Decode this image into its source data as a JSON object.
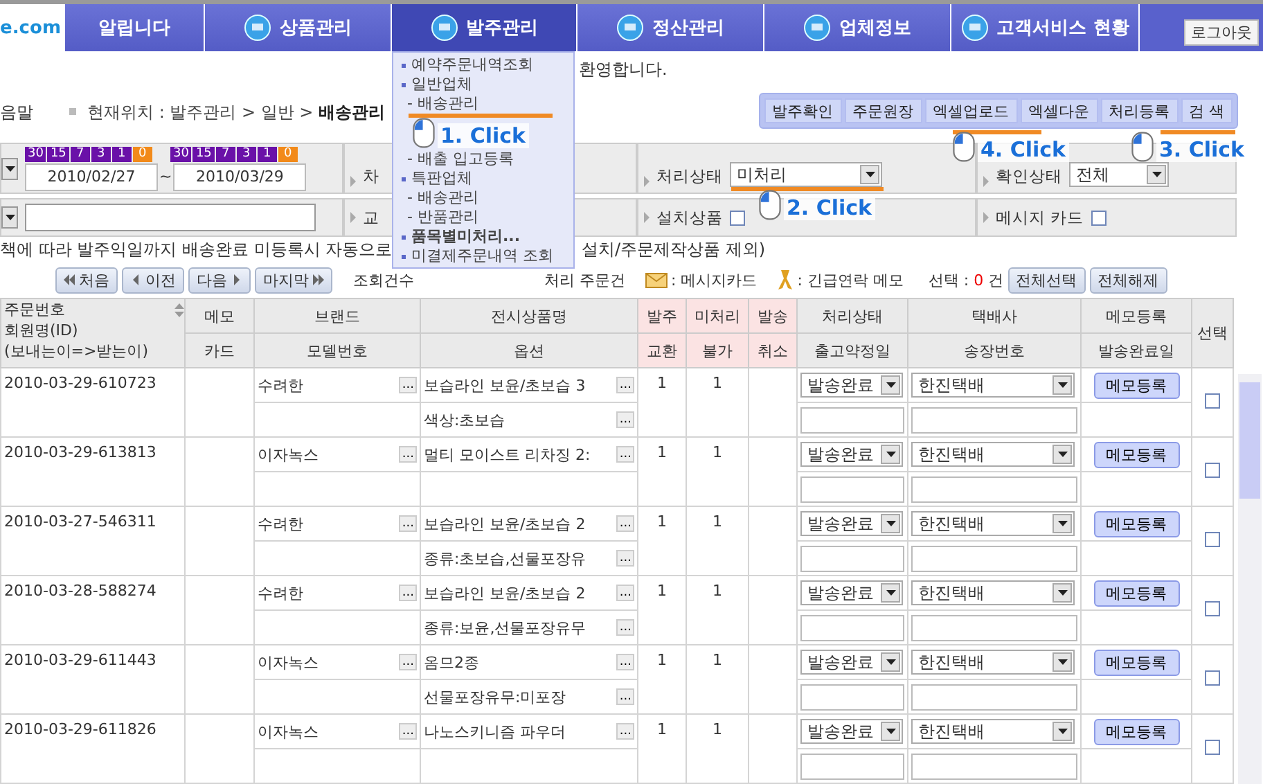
{
  "logo": "e.com",
  "nav": {
    "tabs": [
      {
        "label": "알립니다",
        "selected": false,
        "kind": "plain"
      },
      {
        "label": "상품관리",
        "selected": false,
        "kind": "icon"
      },
      {
        "label": "발주관리",
        "selected": true,
        "kind": "icon"
      },
      {
        "label": "정산관리",
        "selected": false,
        "kind": "icon"
      },
      {
        "label": "업체정보",
        "selected": false,
        "kind": "icon"
      },
      {
        "label": "고객서비스 현황",
        "selected": false,
        "kind": "icon"
      }
    ],
    "logout": "로그아웃"
  },
  "welcome": "환영합니다.",
  "side_label": "음말",
  "breadcrumb": "현재위치 : 발주관리 > 일반 > **배송관리**",
  "actions": [
    "발주확인",
    "주문원장",
    "엑셀업로드",
    "엑셀다운",
    "처리등록",
    "검 색"
  ],
  "filters": {
    "quick_ranges": [
      [
        {
          "label": "30",
          "color": "#6a11a8"
        },
        {
          "label": "15",
          "color": "#6a11a8"
        },
        {
          "label": "7",
          "color": "#6a11a8"
        },
        {
          "label": "3",
          "color": "#6a11a8"
        },
        {
          "label": "1",
          "color": "#6a11a8"
        },
        {
          "label": "0",
          "color": "#f28a1a"
        }
      ],
      [
        {
          "label": "30",
          "color": "#6a11a8"
        },
        {
          "label": "15",
          "color": "#6a11a8"
        },
        {
          "label": "7",
          "color": "#6a11a8"
        },
        {
          "label": "3",
          "color": "#6a11a8"
        },
        {
          "label": "1",
          "color": "#6a11a8"
        },
        {
          "label": "0",
          "color": "#f28a1a"
        }
      ]
    ],
    "date_from": "2010/02/27",
    "date_sep": "~",
    "date_to": "2010/03/29",
    "round_label": "차",
    "exchange_label": "교",
    "status": {
      "label": "처리상태",
      "value": "미처리"
    },
    "confirm": {
      "label": "확인상태",
      "value": "전체"
    },
    "install": {
      "label": "설치상품",
      "checked": false
    },
    "card": {
      "label": "메시지 카드",
      "checked": false
    }
  },
  "notice_left": "책에 따라 발주익일까지 배송완료 미등록시 자동으로",
  "notice_right": "설치/주문제작상품 제외)",
  "pager": [
    "처음",
    "이전",
    "다음",
    "마지막"
  ],
  "count_label": "조회건수",
  "pending_label": "처리 주문건",
  "legend": [
    {
      "kind": "envelope",
      "text": ": 메시지카드"
    },
    {
      "kind": "ribbon",
      "text": ": 긴급연락 메모"
    }
  ],
  "selection": {
    "label": "선택 :",
    "count": "0",
    "unit": "건"
  },
  "select_all": "전체선택",
  "clear_all": "전체해제",
  "table": {
    "columns": [
      {
        "kind": "stacked",
        "lines": [
          "주문번호",
          "회원명(ID)",
          "(보내는이=>받는이)"
        ],
        "highlight": false
      },
      {
        "kind": "split",
        "top": "메모",
        "bottom": "카드",
        "highlight": false
      },
      {
        "kind": "split",
        "top": "브랜드",
        "bottom": "모델번호",
        "highlight": false
      },
      {
        "kind": "split",
        "top": "전시상품명",
        "bottom": "옵션",
        "highlight": false
      },
      {
        "kind": "split",
        "top": "발주",
        "bottom": "교환",
        "highlight": true
      },
      {
        "kind": "split",
        "top": "미처리",
        "bottom": "불가",
        "highlight": true
      },
      {
        "kind": "split",
        "top": "발송",
        "bottom": "취소",
        "highlight": true
      },
      {
        "kind": "split",
        "top": "처리상태",
        "bottom": "출고약정일",
        "highlight": false
      },
      {
        "kind": "split",
        "top": "택배사",
        "bottom": "송장번호",
        "highlight": false
      },
      {
        "kind": "split",
        "top": "메모등록",
        "bottom": "발송완료일",
        "highlight": false
      },
      {
        "kind": "single",
        "top": "선택",
        "highlight": false
      }
    ],
    "rows": [
      {
        "order_no": "2010-03-29-610723",
        "brand": "수려한",
        "brand_more": "...",
        "product": "보습라인 보윤/초보습 3",
        "product_more": "...",
        "option": "색상:초보습",
        "option_more": "...",
        "ordered": "1",
        "pending": "1",
        "status": "발송완료",
        "courier": "한진택배",
        "memo_button": "메모등록",
        "checked": false
      },
      {
        "order_no": "2010-03-29-613813",
        "brand": "이자녹스",
        "brand_more": "...",
        "product": "멀티 모이스트 리차징 2:",
        "product_more": "...",
        "ordered": "1",
        "pending": "1",
        "status": "발송완료",
        "courier": "한진택배",
        "memo_button": "메모등록",
        "checked": false
      },
      {
        "order_no": "2010-03-27-546311",
        "brand": "수려한",
        "brand_more": "...",
        "product": "보습라인 보윤/초보습 2",
        "product_more": "...",
        "option": "종류:초보습,선물포장유",
        "option_more": "...",
        "ordered": "1",
        "pending": "1",
        "status": "발송완료",
        "courier": "한진택배",
        "memo_button": "메모등록",
        "checked": false
      },
      {
        "order_no": "2010-03-28-588274",
        "brand": "수려한",
        "brand_more": "...",
        "product": "보습라인 보윤/초보습 2",
        "product_more": "...",
        "option": "종류:보윤,선물포장유무",
        "option_more": "...",
        "ordered": "1",
        "pending": "1",
        "status": "발송완료",
        "courier": "한진택배",
        "memo_button": "메모등록",
        "checked": false
      },
      {
        "order_no": "2010-03-29-611443",
        "brand": "이자녹스",
        "brand_more": "...",
        "product": "옴므2종",
        "product_more": "...",
        "option": "선물포장유무:미포장",
        "option_more": "...",
        "ordered": "1",
        "pending": "1",
        "status": "발송완료",
        "courier": "한진택배",
        "memo_button": "메모등록",
        "checked": false
      },
      {
        "order_no": "2010-03-29-611826",
        "brand": "이자녹스",
        "brand_more": "...",
        "product": "나노스키니즘 파우더",
        "product_more": "...",
        "ordered": "1",
        "pending": "1",
        "status": "발송완료",
        "courier": "한진택배",
        "memo_button": "메모등록",
        "checked": false
      }
    ]
  },
  "menu": [
    {
      "kind": "section",
      "label": "예약주문내역조회",
      "bold": false
    },
    {
      "kind": "section",
      "label": "일반업체",
      "bold": false
    },
    {
      "kind": "sub",
      "label": "- 배송관리",
      "bold": false
    },
    {
      "kind": "sub",
      "label": "- 배출 입고등록",
      "bold": false
    },
    {
      "kind": "section",
      "label": "특판업체",
      "bold": false
    },
    {
      "kind": "sub",
      "label": "- 배송관리",
      "bold": false
    },
    {
      "kind": "sub",
      "label": "- 반품관리",
      "bold": false
    },
    {
      "kind": "section",
      "label": "품목별미처리...",
      "bold": true
    },
    {
      "kind": "section",
      "label": "미결제주문내역 조회",
      "bold": false
    }
  ],
  "callouts": [
    {
      "label": "1. Click"
    },
    {
      "label": "4. Click"
    },
    {
      "label": "3. Click"
    },
    {
      "label": "2. Click"
    }
  ]
}
